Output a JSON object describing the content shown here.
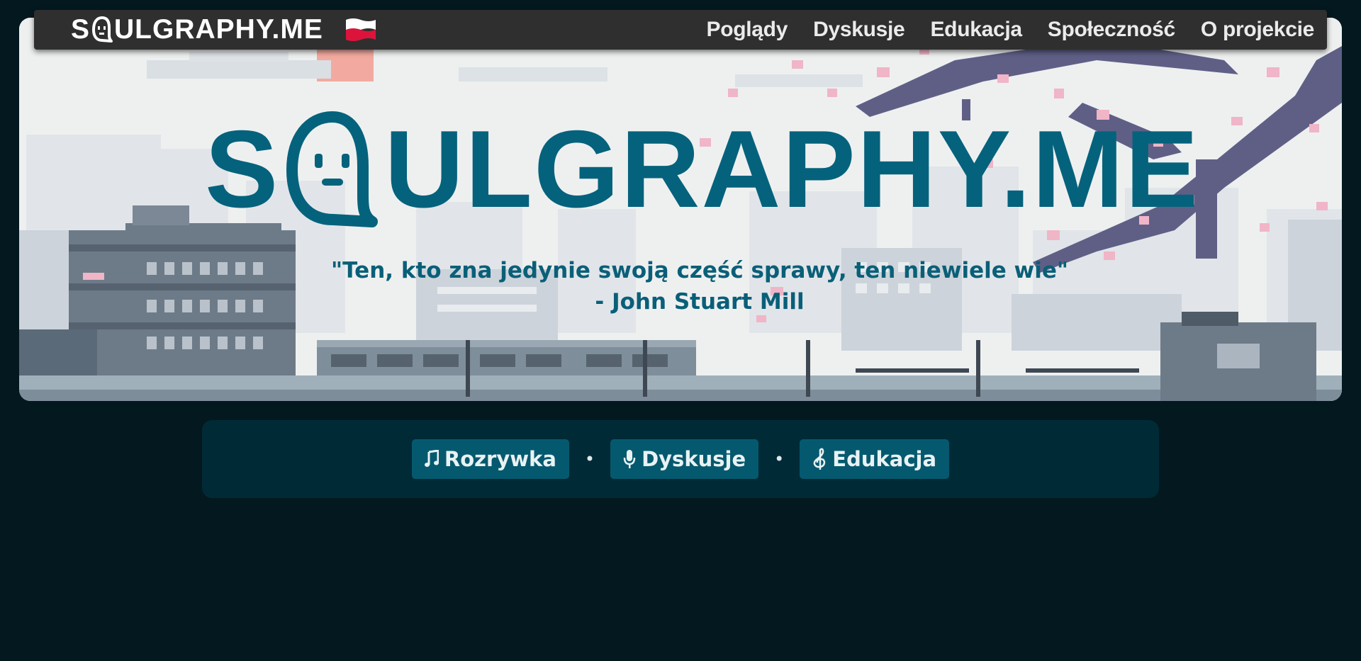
{
  "navbar": {
    "brand_prefix": "S",
    "brand_suffix": "ULGRAPHY.ME",
    "items": [
      {
        "label": "Poglądy"
      },
      {
        "label": "Dyskusje"
      },
      {
        "label": "Edukacja"
      },
      {
        "label": "Społeczność"
      },
      {
        "label": "O projekcie"
      }
    ]
  },
  "hero": {
    "title_prefix": "S",
    "title_suffix": "ULGRAPHY.ME",
    "quote": "\"Ten, kto zna jedynie swoją część sprawy, ten niewiele wie\" - John Stuart Mill"
  },
  "categories": [
    {
      "icon": "music-note-icon",
      "label": "Rozrywka"
    },
    {
      "icon": "microphone-icon",
      "label": "Dyskusje"
    },
    {
      "icon": "treble-clef-icon",
      "label": "Edukacja"
    }
  ],
  "separator": "•",
  "colors": {
    "background": "#03191f",
    "navbar": "#2f2f2f",
    "brand_teal": "#05627c",
    "category_bar": "#012a37",
    "category_button": "#05596e"
  }
}
